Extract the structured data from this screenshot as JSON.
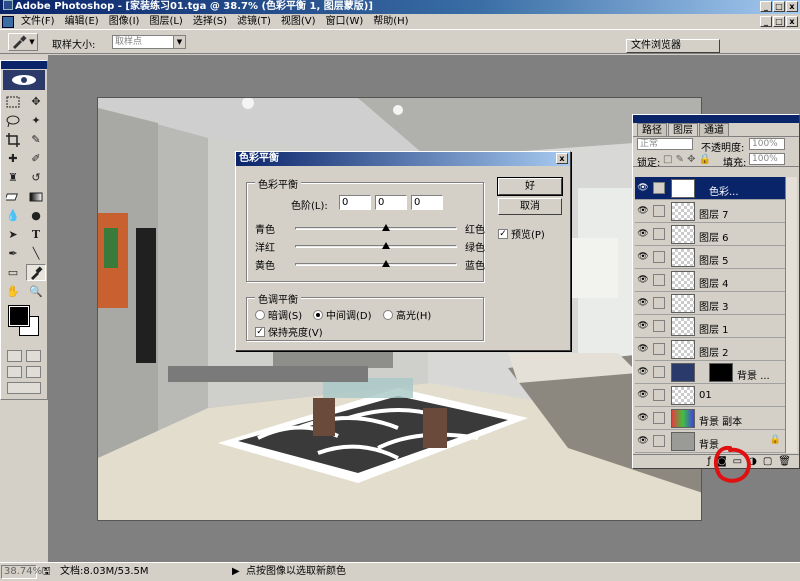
{
  "window": {
    "title": "Adobe Photoshop - [家装练习01.tga @ 38.7% (色彩平衡 1, 图层蒙版)]",
    "minimize": "_",
    "restore": "□",
    "close": "x"
  },
  "menu": {
    "items": [
      "文件(F)",
      "编辑(E)",
      "图像(I)",
      "图层(L)",
      "选择(S)",
      "滤镜(T)",
      "视图(V)",
      "窗口(W)",
      "帮助(H)"
    ]
  },
  "options_bar": {
    "sample_size_label": "取样大小:",
    "sample_size_value": "取样点",
    "file_browser": "文件浏览器"
  },
  "color_balance_dialog": {
    "title": "色彩平衡",
    "close": "x",
    "group_balance": "色彩平衡",
    "levels_label": "色阶(L):",
    "levels": [
      "0",
      "0",
      "0"
    ],
    "sliders": [
      {
        "left": "青色",
        "right": "红色",
        "value": 0
      },
      {
        "left": "洋红",
        "right": "绿色",
        "value": 0
      },
      {
        "left": "黄色",
        "right": "蓝色",
        "value": 0
      }
    ],
    "group_tone": "色调平衡",
    "tone_options": [
      "暗调(S)",
      "中间调(D)",
      "高光(H)"
    ],
    "tone_selected": "中间调(D)",
    "preserve_luminosity": "保持亮度(V)",
    "preserve_checked": true,
    "ok": "好",
    "cancel": "取消",
    "preview": "预览(P)",
    "preview_checked": true
  },
  "layers_panel": {
    "tabs": [
      "路径",
      "图层",
      "通道"
    ],
    "active_tab": "图层",
    "blend_mode": "正常",
    "opacity_label": "不透明度:",
    "opacity_value": "100%",
    "lock_label": "锁定:",
    "fill_label": "填充:",
    "fill_value": "100%",
    "layers": [
      {
        "name": "色彩...",
        "selected": true
      },
      {
        "name": "图层 7",
        "selected": false
      },
      {
        "name": "图层 6",
        "selected": false
      },
      {
        "name": "图层 5",
        "selected": false
      },
      {
        "name": "图层 4",
        "selected": false
      },
      {
        "name": "图层 3",
        "selected": false
      },
      {
        "name": "图层 1",
        "selected": false
      },
      {
        "name": "图层 2",
        "selected": false
      },
      {
        "name": "背景 ...",
        "selected": false
      },
      {
        "name": "01",
        "selected": false
      },
      {
        "name": "背景 副本",
        "selected": false
      },
      {
        "name": "背景",
        "selected": false
      }
    ]
  },
  "status": {
    "zoom": "38.74%",
    "doc_size": "文档:8.03M/53.5M",
    "hint": "点按图像以选取新颜色"
  }
}
